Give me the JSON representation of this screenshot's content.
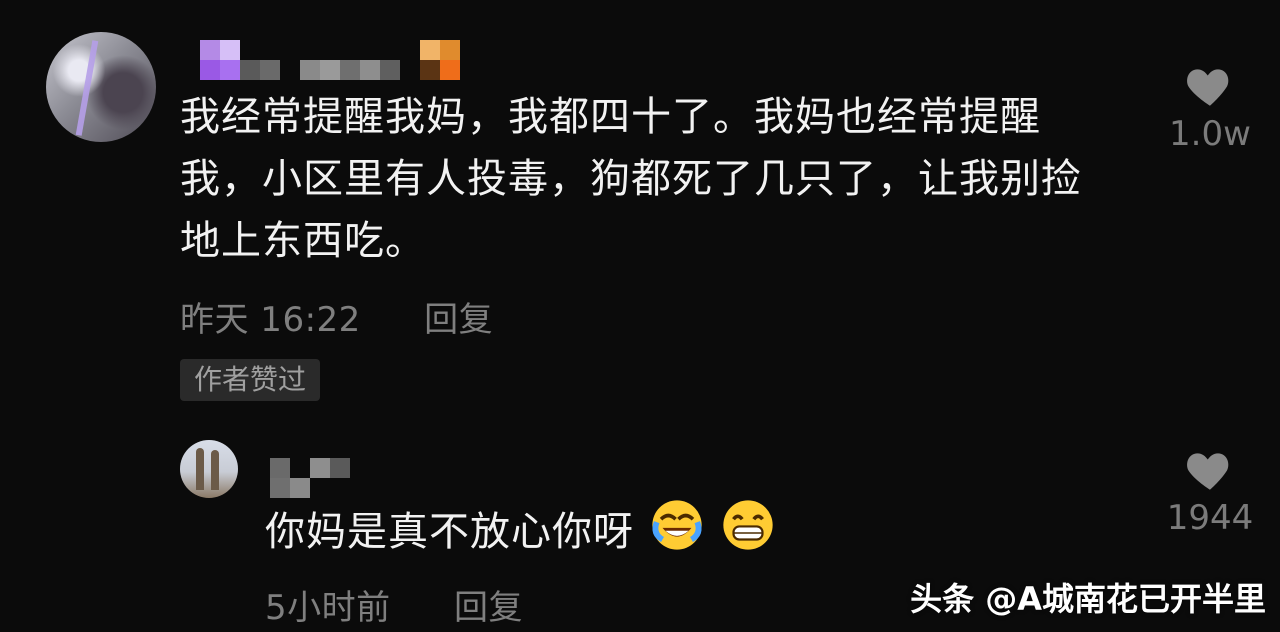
{
  "main_comment": {
    "text": "我经常提醒我妈，我都四十了。我妈也经常提醒我，小区里有人投毒，狗都死了几只了，让我别捡地上东西吃。",
    "time": "昨天 16:22",
    "reply_label": "回复",
    "badge": "作者赞过",
    "like_count": "1.0w"
  },
  "reply_comment": {
    "text": "你妈是真不放心你呀",
    "time": "5小时前",
    "reply_label": "回复",
    "like_count": "1944"
  },
  "watermark": "头条 @A城南花已开半里",
  "colors": {
    "background": "#0b0b0b",
    "text": "#f2f2f2",
    "meta": "#7f7f7f",
    "heart": "#8a8a8a"
  }
}
